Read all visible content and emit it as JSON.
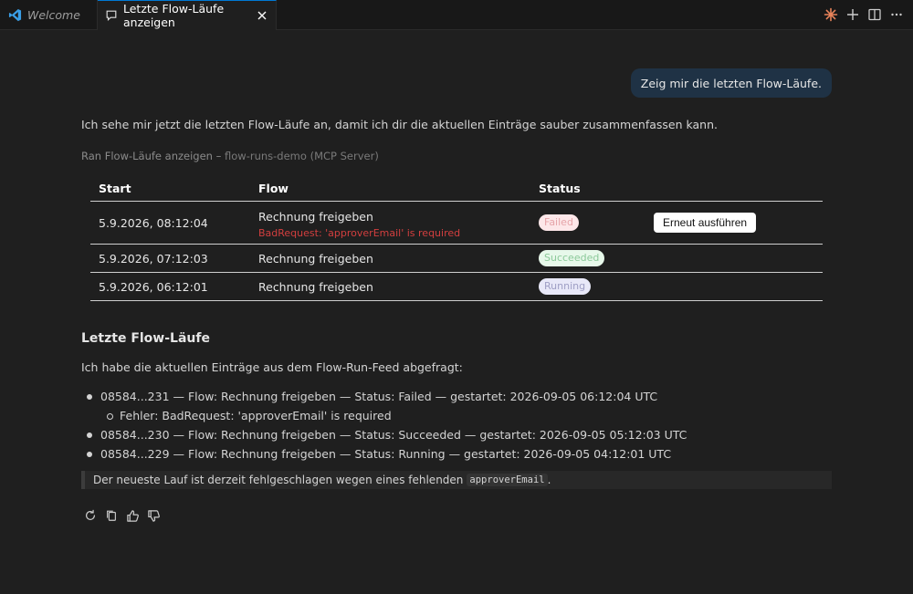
{
  "tabs": [
    {
      "label": "Welcome",
      "icon": "vscode-logo-icon"
    },
    {
      "label": "Letzte Flow-Läufe anzeigen",
      "icon": "chat-icon",
      "active": true
    }
  ],
  "editor_actions": [
    "sparkle-icon",
    "plus-icon",
    "split-editor-icon",
    "more-icon"
  ],
  "user_message": "Zeig mir die letzten Flow-Läufe.",
  "assistant_intro": "Ich sehe mir jetzt die letzten Flow-Läufe an, damit ich dir die aktuellen Einträge sauber zusammenfassen kann.",
  "tool_call": {
    "prefix": "Ran Flow-Läufe anzeigen",
    "separator": " – ",
    "source": "flow-runs-demo (MCP Server)"
  },
  "table": {
    "headers": {
      "start": "Start",
      "flow": "Flow",
      "status": "Status"
    },
    "rows": [
      {
        "start": "5.9.2026, 08:12:04",
        "flow": "Rechnung freigeben",
        "error": "BadRequest: 'approverEmail' is required",
        "status": "Failed",
        "action": "Erneut ausführen"
      },
      {
        "start": "5.9.2026, 07:12:03",
        "flow": "Rechnung freigeben",
        "status": "Succeeded"
      },
      {
        "start": "5.9.2026, 06:12:01",
        "flow": "Rechnung freigeben",
        "status": "Running"
      }
    ]
  },
  "summary": {
    "heading": "Letzte Flow-Läufe",
    "paragraph": "Ich habe die aktuellen Einträge aus dem Flow-Run-Feed abgefragt:",
    "items": [
      "08584...231 — Flow: Rechnung freigeben — Status: Failed — gestartet: 2026-09-05 06:12:04 UTC",
      "08584...230 — Flow: Rechnung freigeben — Status: Succeeded — gestartet: 2026-09-05 05:12:03 UTC",
      "08584...229 — Flow: Rechnung freigeben — Status: Running — gestartet: 2026-09-05 04:12:01 UTC"
    ],
    "sub_item": "Fehler: BadRequest: 'approverEmail' is required",
    "quote_text": "Der neueste Lauf ist derzeit fehlgeschlagen wegen eines fehlenden",
    "quote_code": "approverEmail",
    "quote_end": "."
  },
  "response_actions": [
    "retry-icon",
    "copy-icon",
    "thumbs-up-icon",
    "thumbs-down-icon"
  ],
  "colors": {
    "accent": "#0078d4",
    "bubble": "#1f3245",
    "error": "#d33f3f",
    "failed_bg": "#fde7e9",
    "succeeded_bg": "#e7f8ea",
    "running_bg": "#e8e8f8"
  }
}
